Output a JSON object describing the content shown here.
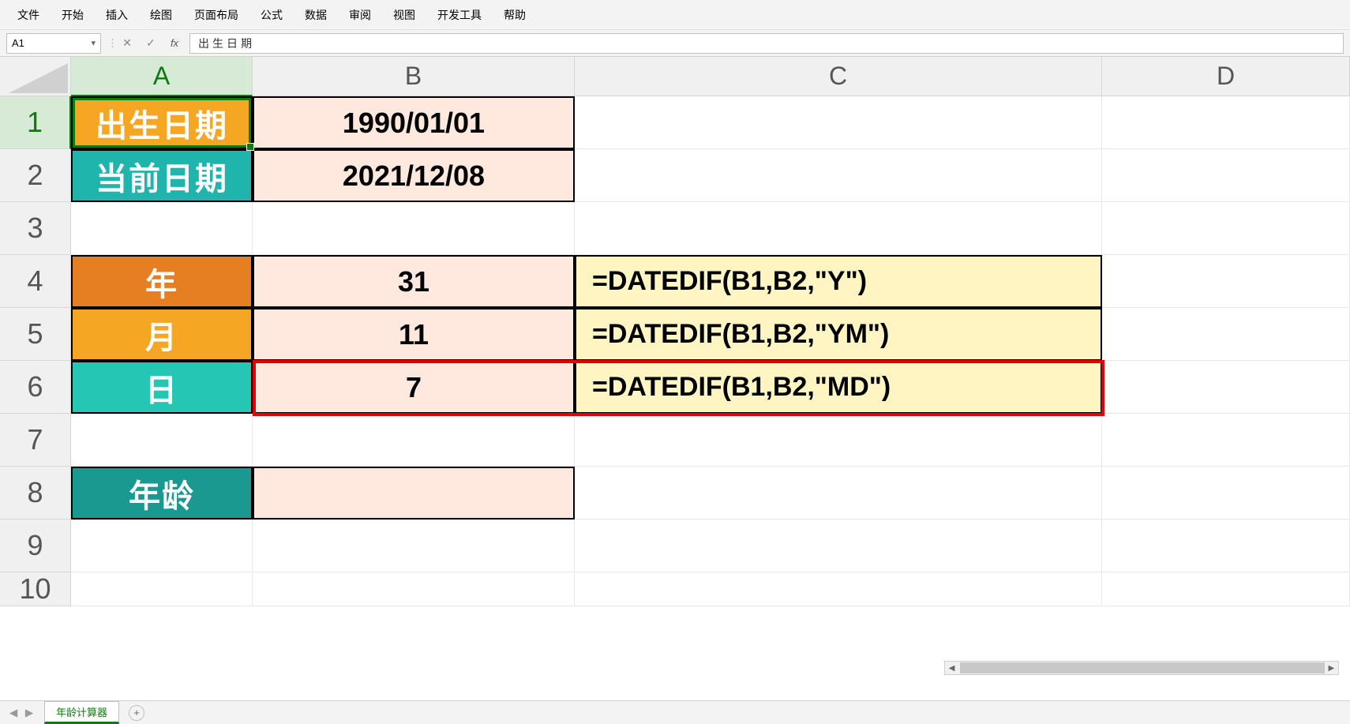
{
  "menu": {
    "items": [
      "文件",
      "开始",
      "插入",
      "绘图",
      "页面布局",
      "公式",
      "数据",
      "审阅",
      "视图",
      "开发工具",
      "帮助"
    ]
  },
  "formula_bar": {
    "name_box": "A1",
    "formula": "出生日期"
  },
  "columns": [
    "A",
    "B",
    "C",
    "D"
  ],
  "row_numbers": [
    "1",
    "2",
    "3",
    "4",
    "5",
    "6",
    "7",
    "8",
    "9",
    "10"
  ],
  "cells": {
    "A1": "出生日期",
    "B1": "1990/01/01",
    "A2": "当前日期",
    "B2": "2021/12/08",
    "A4": "年",
    "B4": "31",
    "C4": "=DATEDIF(B1,B2,\"Y\")",
    "A5": "月",
    "B5": "11",
    "C5": "=DATEDIF(B1,B2,\"YM\")",
    "A6": "日",
    "B6": "7",
    "C6": "=DATEDIF(B1,B2,\"MD\")",
    "A8": "年龄"
  },
  "sheet": {
    "name": "年龄计算器"
  }
}
